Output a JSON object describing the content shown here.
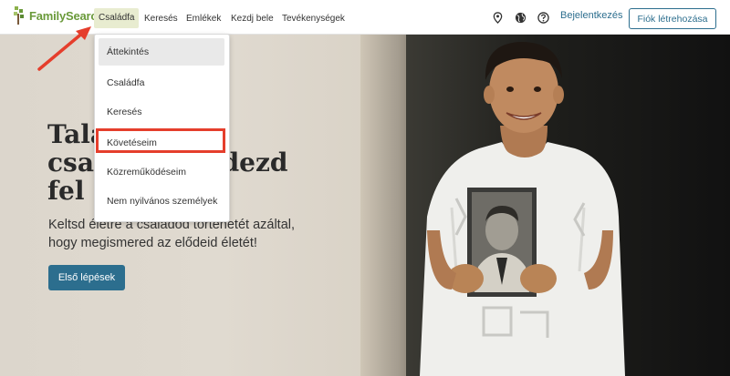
{
  "header": {
    "logo_text": "FamilySearch",
    "nav": [
      "Családfa",
      "Keresés",
      "Emlékek",
      "Kezdj bele",
      "Tevékenységek"
    ],
    "active_nav": "Családfa",
    "icons": [
      "location-pin-icon",
      "globe-icon",
      "help-icon"
    ],
    "signin_label": "Bejelentkezés",
    "create_account_label": "Fiók létrehozása"
  },
  "dropdown": {
    "items": [
      "Áttekintés",
      "Családfa",
      "Keresés",
      "Követéseim",
      "Közreműködéseim",
      "Nem nyilvános személyek"
    ],
    "highlighted": "Áttekintés",
    "annotated": "Követéseim"
  },
  "hero": {
    "headline": "Találd meg a családodat, és fedezd fel múltját",
    "headline_visible": [
      "Talá",
      "csal",
      "dezd",
      "fel m"
    ],
    "subtitle": "Keltsd életre a családod történetét azáltal, hogy megismered az elődeid életét!",
    "cta_label": "Első lépések"
  },
  "colors": {
    "brand_green": "#6a9a3a",
    "accent_blue": "#2c6e8e",
    "annotation_red": "#e53e2c"
  }
}
